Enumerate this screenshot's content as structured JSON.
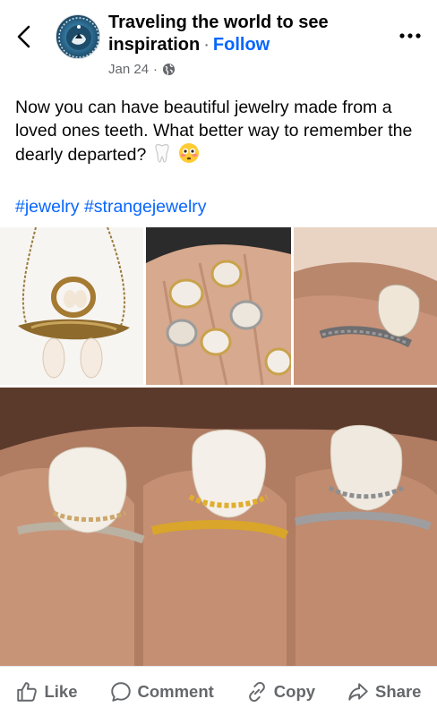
{
  "post": {
    "page_name_line1": "Traveling the world to see",
    "page_name_line2": "inspiration",
    "follow_label": "Follow",
    "date": "Jan 24",
    "audience_icon": "globe-icon",
    "text": "Now you can have beautiful jewelry made from a loved ones teeth. What better way to remember the dearly departed?",
    "emojis": [
      "tooth-emoji",
      "flushed-face-emoji"
    ],
    "hashtags": [
      "#jewelry",
      "#strangejewelry"
    ]
  },
  "photos": [
    {
      "content": "tooth necklace and ring on white background"
    },
    {
      "content": "hand wearing several tooth rings"
    },
    {
      "content": "silver ring with molar on finger"
    },
    {
      "content": "three molar rings on fingers: gold, gold, silver"
    }
  ],
  "actions": {
    "like_label": "Like",
    "comment_label": "Comment",
    "copy_label": "Copy",
    "share_label": "Share"
  },
  "colors": {
    "link_blue": "#0866ff",
    "secondary_text": "#65676b",
    "primary_text": "#050505"
  }
}
